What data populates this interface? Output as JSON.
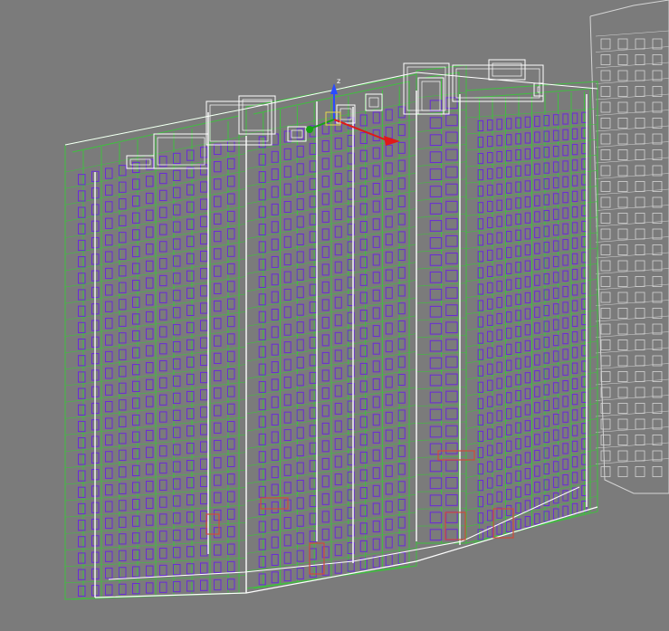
{
  "viewport": {
    "background": "#7b7b7b",
    "view_label": ""
  },
  "colors": {
    "structure": "#3fbf3f",
    "windows": "#6a2bd8",
    "selected": "#ffffff",
    "neighbor": "#d4d4d4",
    "door": "#d04a3a"
  },
  "gizmo": {
    "axes": [
      {
        "name": "z",
        "label": "z",
        "color": "#2a4bff"
      },
      {
        "name": "x",
        "label": "",
        "color": "#e01818"
      },
      {
        "name": "y",
        "label": "",
        "color": "#15a515"
      }
    ]
  },
  "building": {
    "blocks": 4,
    "floors": 26,
    "selected_object": "building-wireframe"
  }
}
